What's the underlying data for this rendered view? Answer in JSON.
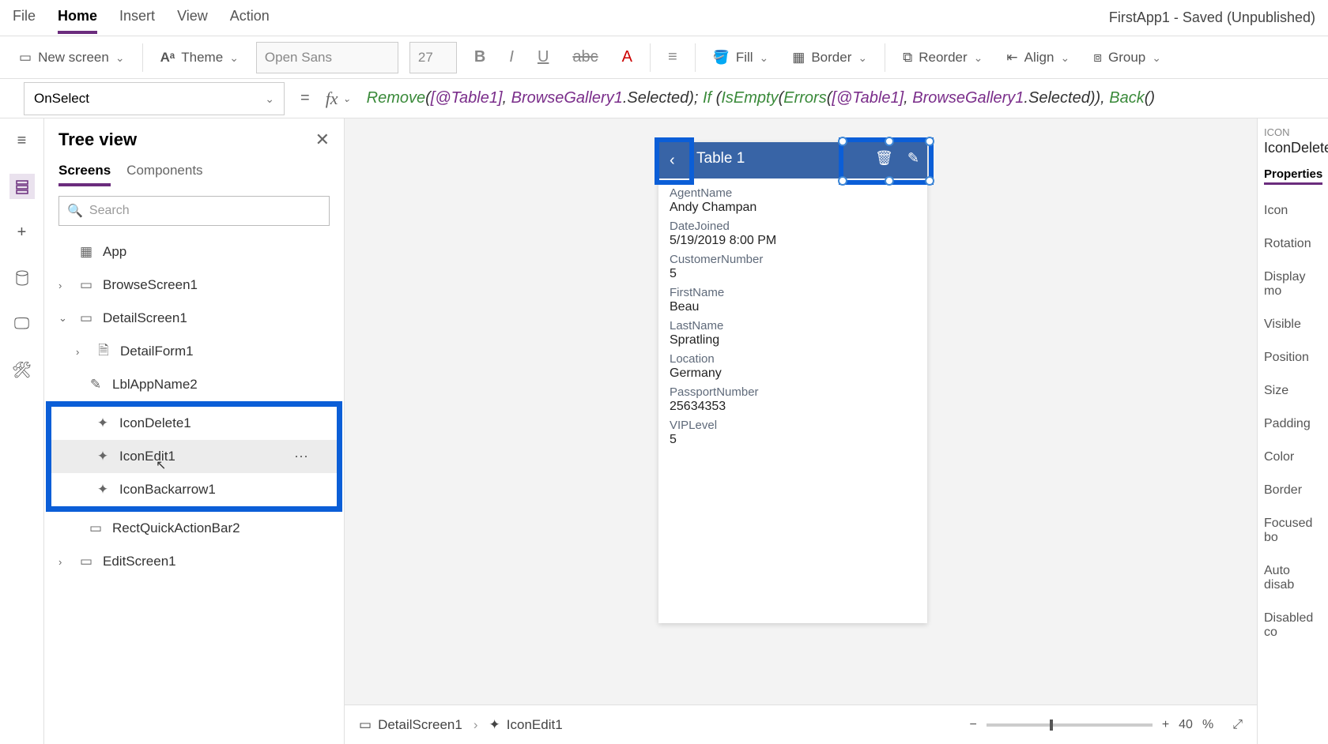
{
  "topbar": {
    "tabs": {
      "file": "File",
      "home": "Home",
      "insert": "Insert",
      "view": "View",
      "action": "Action"
    },
    "title": "FirstApp1 - Saved (Unpublished)"
  },
  "ribbon": {
    "newscreen": "New screen",
    "theme": "Theme",
    "font_name": "Open Sans",
    "font_size": "27",
    "fill": "Fill",
    "border": "Border",
    "reorder": "Reorder",
    "align": "Align",
    "group": "Group"
  },
  "formulabar": {
    "prop": "OnSelect",
    "tokens": [
      "Remove",
      "(",
      "[@Table1]",
      ", ",
      "BrowseGallery1",
      ".Selected",
      "); ",
      "If",
      " (",
      "IsEmpty",
      "(",
      "Errors",
      "(",
      "[@Table1]",
      ", ",
      "BrowseGallery1",
      ".Selected",
      ")), ",
      "Back",
      "()"
    ]
  },
  "tree": {
    "title": "Tree view",
    "tabs": {
      "screens": "Screens",
      "components": "Components"
    },
    "search_placeholder": "Search",
    "items": {
      "app": "App",
      "browse": "BrowseScreen1",
      "detail": "DetailScreen1",
      "detailform": "DetailForm1",
      "lblapp": "LblAppName2",
      "icondelete": "IconDelete1",
      "iconedit": "IconEdit1",
      "iconback": "IconBackarrow1",
      "rect": "RectQuickActionBar2",
      "edit": "EditScreen1"
    }
  },
  "phone": {
    "title": "Table 1",
    "fields": [
      {
        "label": "AgentName",
        "value": "Andy Champan"
      },
      {
        "label": "DateJoined",
        "value": "5/19/2019 8:00 PM"
      },
      {
        "label": "CustomerNumber",
        "value": "5"
      },
      {
        "label": "FirstName",
        "value": "Beau"
      },
      {
        "label": "LastName",
        "value": "Spratling"
      },
      {
        "label": "Location",
        "value": "Germany"
      },
      {
        "label": "PassportNumber",
        "value": "25634353"
      },
      {
        "label": "VIPLevel",
        "value": "5"
      }
    ]
  },
  "breadcrumb": {
    "screen": "DetailScreen1",
    "control": "IconEdit1"
  },
  "zoom": {
    "value": "40",
    "unit": "%"
  },
  "props": {
    "kind": "ICON",
    "name": "IconDelete",
    "tab": "Properties",
    "rows": [
      "Icon",
      "Rotation",
      "Display mo",
      "Visible",
      "Position",
      "Size",
      "Padding",
      "Color",
      "Border",
      "Focused bo",
      "Auto disab",
      "Disabled co"
    ]
  }
}
